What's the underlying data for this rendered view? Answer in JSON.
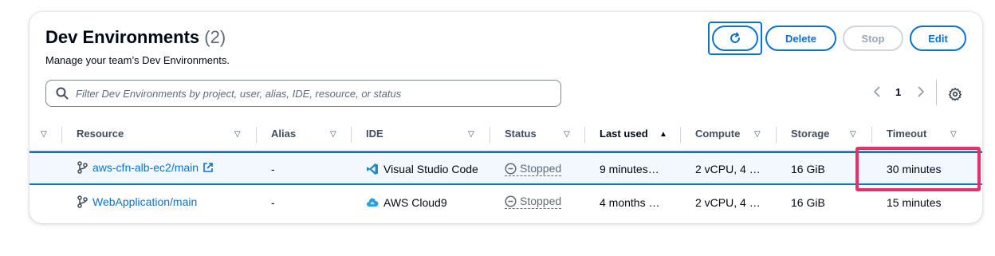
{
  "header": {
    "title": "Dev Environments",
    "count": "(2)",
    "description": "Manage your team’s Dev Environments."
  },
  "actions": {
    "delete_label": "Delete",
    "stop_label": "Stop",
    "edit_label": "Edit"
  },
  "filter": {
    "placeholder": "Filter Dev Environments by project, user, alias, IDE, resource, or status"
  },
  "pagination": {
    "current_page": "1"
  },
  "columns": {
    "resource": "Resource",
    "alias": "Alias",
    "ide": "IDE",
    "status": "Status",
    "last_used": "Last used",
    "compute": "Compute",
    "storage": "Storage",
    "timeout": "Timeout"
  },
  "rows": [
    {
      "resource": "aws-cfn-alb-ec2/main",
      "alias": "-",
      "ide": "Visual Studio Code",
      "status": "Stopped",
      "last_used": "9 minutes…",
      "compute": "2 vCPU, 4 …",
      "storage": "16 GiB",
      "timeout": "30 minutes",
      "selected": true
    },
    {
      "resource": "WebApplication/main",
      "alias": "-",
      "ide": "AWS Cloud9",
      "status": "Stopped",
      "last_used": "4 months …",
      "compute": "2 vCPU, 4 …",
      "storage": "16 GiB",
      "timeout": "15 minutes",
      "selected": false
    }
  ],
  "colors": {
    "accent": "#0972d3",
    "highlight": "#e6306a",
    "selected_row_bg": "#f2f8fd"
  }
}
